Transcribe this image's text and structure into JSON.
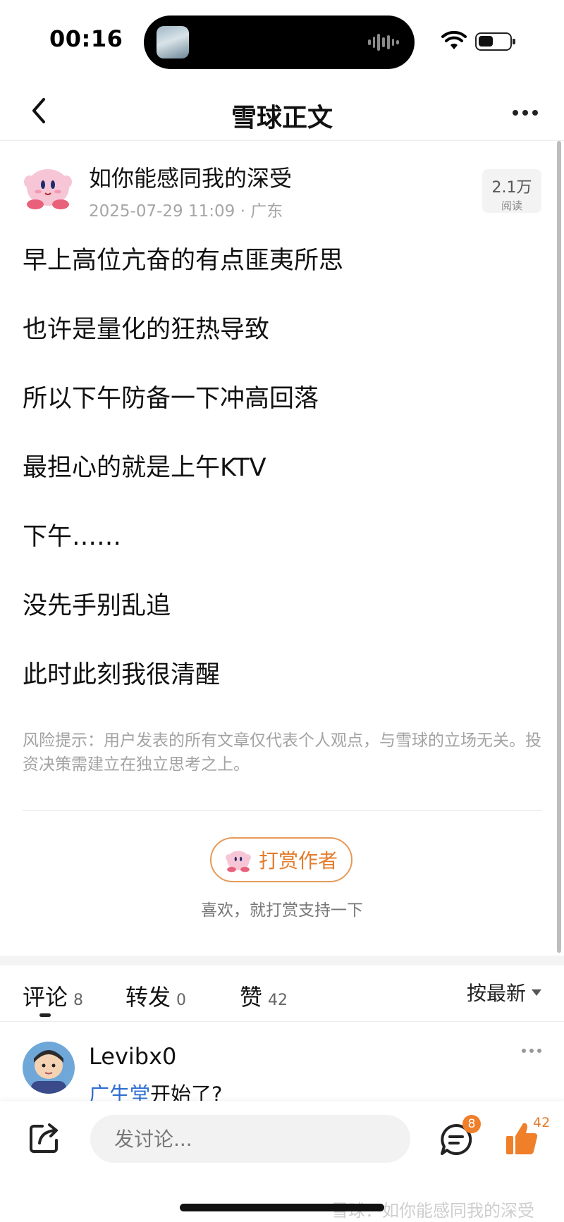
{
  "status_bar": {
    "time": "00:16"
  },
  "nav": {
    "title": "雪球正文"
  },
  "post": {
    "author": "如你能感同我的深受",
    "meta": "2025-07-29 11:09 · 广东",
    "read_count": "2.1万",
    "read_label": "阅读",
    "lines": [
      "早上高位亢奋的有点匪夷所思",
      "也许是量化的狂热导致",
      "所以下午防备一下冲高回落",
      "最担心的就是上午KTV",
      "下午……",
      "没先手别乱追",
      "此时此刻我很清醒"
    ],
    "risk_note": "风险提示：用户发表的所有文章仅代表个人观点，与雪球的立场无关。投资决策需建立在独立思考之上。"
  },
  "tip": {
    "button_label": "打赏作者",
    "subtext": "喜欢，就打赏支持一下"
  },
  "tabs": {
    "comments_label": "评论",
    "comments_count": "8",
    "reposts_label": "转发",
    "reposts_count": "0",
    "likes_label": "赞",
    "likes_count": "42",
    "sort_label": "按最新"
  },
  "comment": {
    "user": "Levibx0",
    "mention": "广生堂",
    "text": "开始了?"
  },
  "bottom_bar": {
    "input_placeholder": "发讨论...",
    "comments_badge": "8",
    "like_count": "42",
    "watermark": "雪球：如你能感同我的深受"
  },
  "colors": {
    "accent_orange": "#e37c2c",
    "link_blue": "#2f6fd1",
    "muted_gray": "#a6a6a6"
  },
  "icons": {
    "back": "chevron-left-icon",
    "more": "more-dots-icon",
    "share": "share-icon",
    "comments": "comment-bubble-icon",
    "like": "thumbs-up-icon",
    "wifi": "wifi-icon",
    "battery": "battery-icon"
  }
}
